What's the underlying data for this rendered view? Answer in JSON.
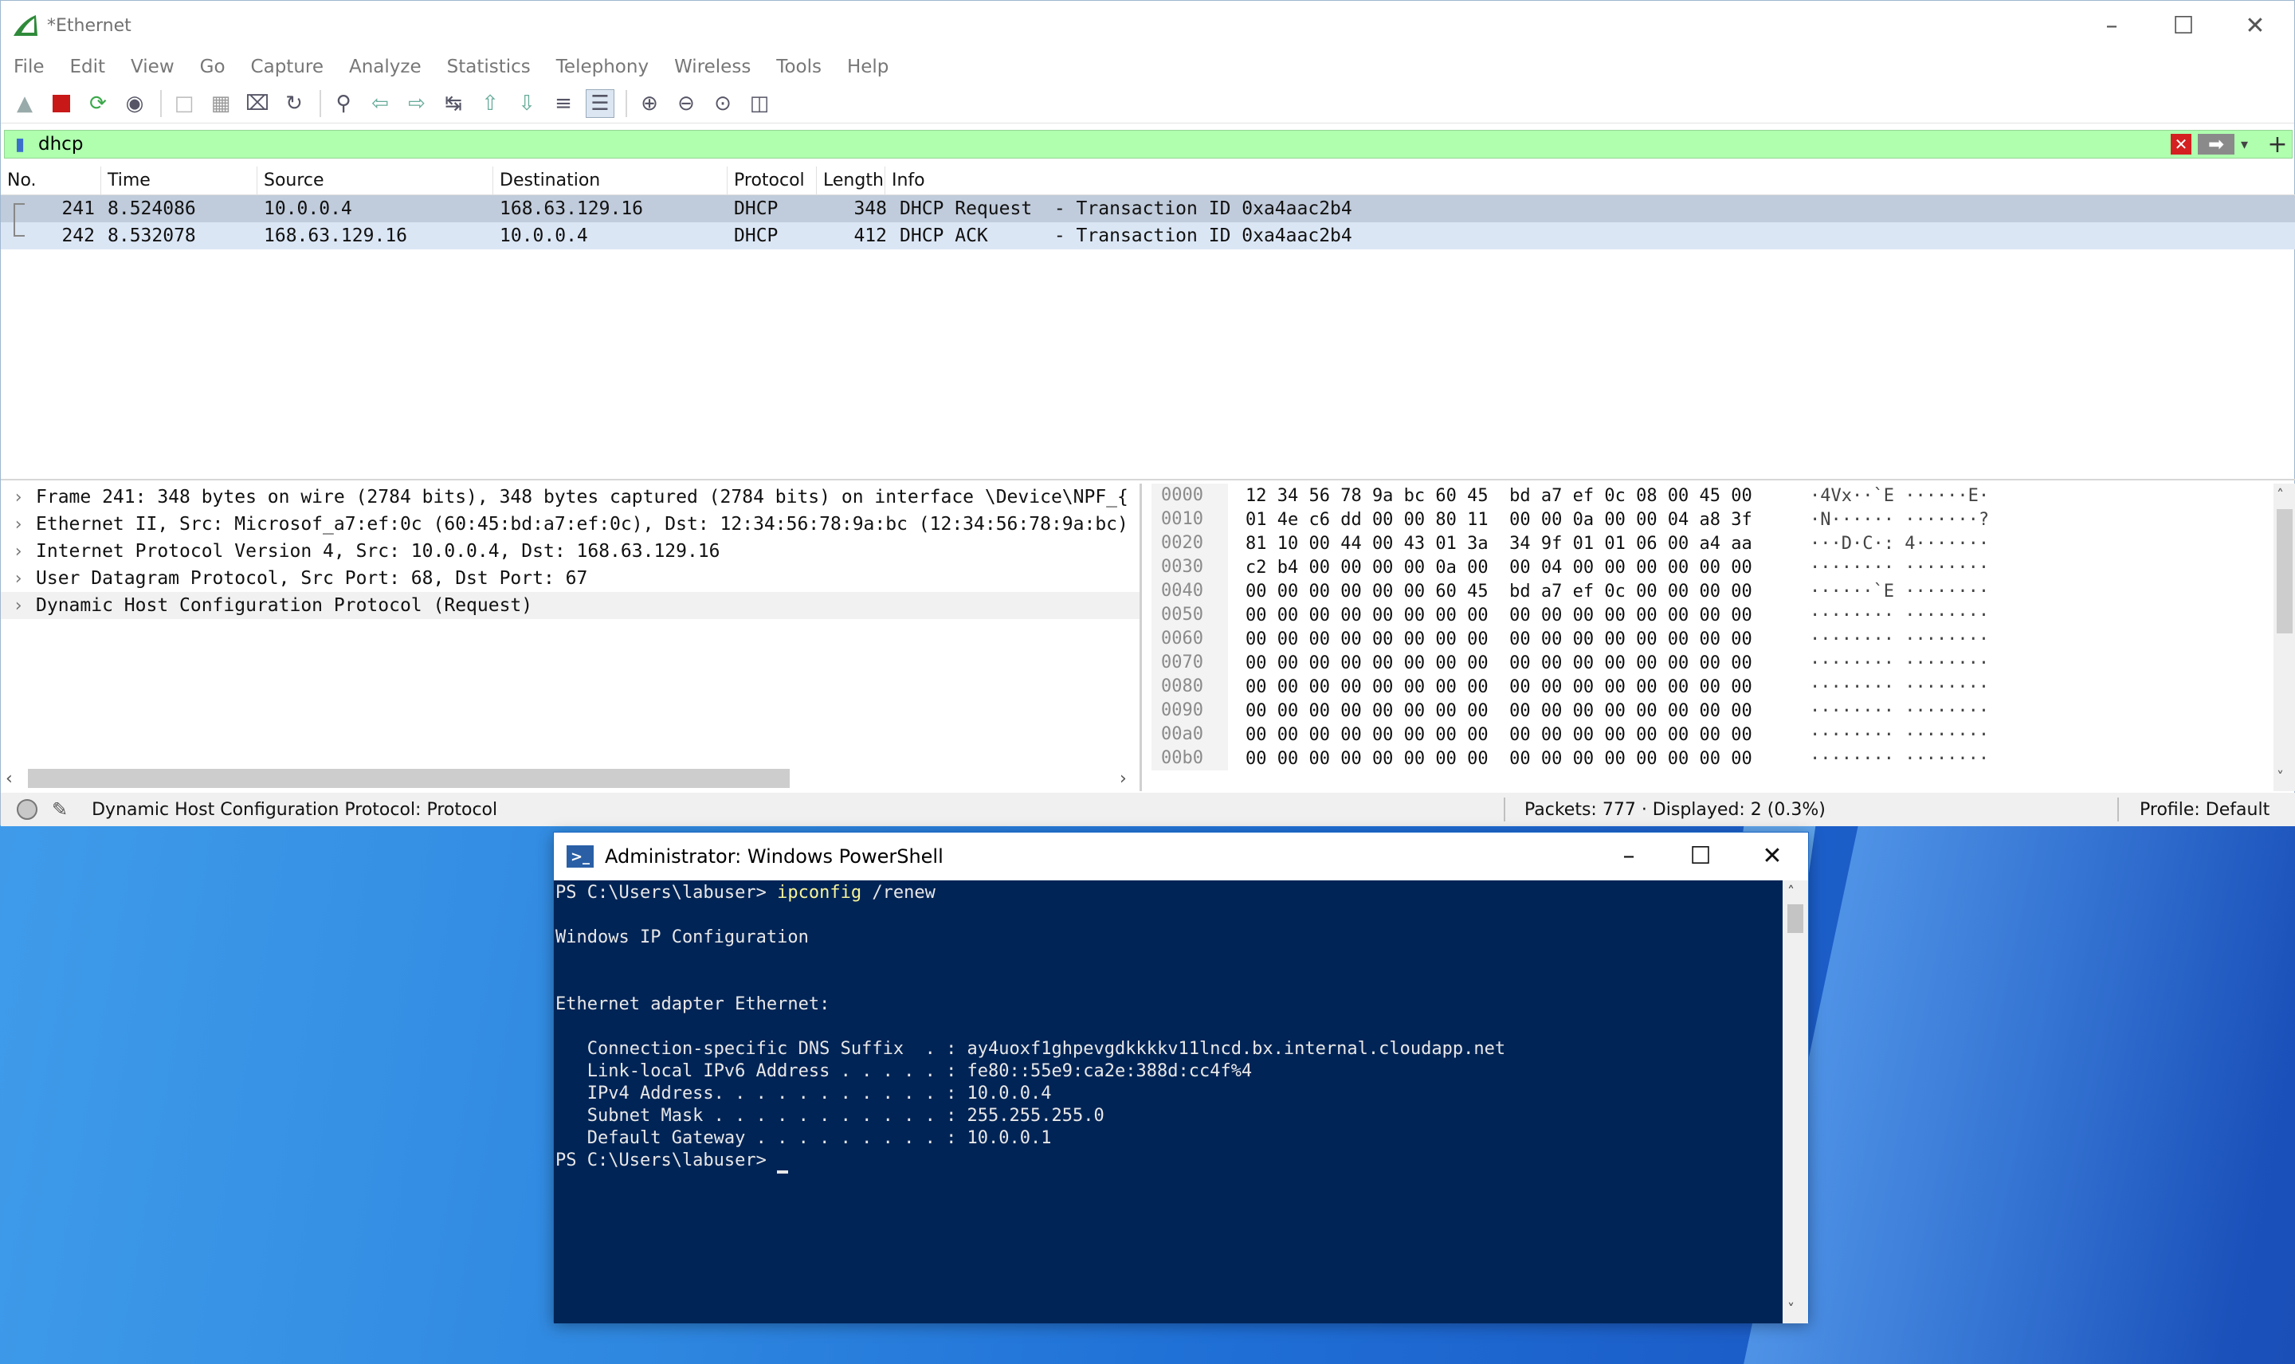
{
  "wireshark": {
    "title": "*Ethernet",
    "menu": [
      "File",
      "Edit",
      "View",
      "Go",
      "Capture",
      "Analyze",
      "Statistics",
      "Telephony",
      "Wireless",
      "Tools",
      "Help"
    ],
    "filter": {
      "value": "dhcp"
    },
    "columns": {
      "no": "No.",
      "time": "Time",
      "source": "Source",
      "destination": "Destination",
      "protocol": "Protocol",
      "length": "Length",
      "info": "Info"
    },
    "packets": [
      {
        "no": "241",
        "time": "8.524086",
        "source": "10.0.0.4",
        "destination": "168.63.129.16",
        "protocol": "DHCP",
        "length": "348",
        "info": "DHCP Request  - Transaction ID 0xa4aac2b4"
      },
      {
        "no": "242",
        "time": "8.532078",
        "source": "168.63.129.16",
        "destination": "10.0.0.4",
        "protocol": "DHCP",
        "length": "412",
        "info": "DHCP ACK      - Transaction ID 0xa4aac2b4"
      }
    ],
    "details": [
      "Frame 241: 348 bytes on wire (2784 bits), 348 bytes captured (2784 bits) on interface \\Device\\NPF_{",
      "Ethernet II, Src: Microsof_a7:ef:0c (60:45:bd:a7:ef:0c), Dst: 12:34:56:78:9a:bc (12:34:56:78:9a:bc)",
      "Internet Protocol Version 4, Src: 10.0.0.4, Dst: 168.63.129.16",
      "User Datagram Protocol, Src Port: 68, Dst Port: 67",
      "Dynamic Host Configuration Protocol (Request)"
    ],
    "bytes": [
      {
        "offset": "0000",
        "hex": "12 34 56 78 9a bc 60 45  bd a7 ef 0c 08 00 45 00",
        "ascii": "·4Vx··`E ······E·"
      },
      {
        "offset": "0010",
        "hex": "01 4e c6 dd 00 00 80 11  00 00 0a 00 00 04 a8 3f",
        "ascii": "·N······ ·······?"
      },
      {
        "offset": "0020",
        "hex": "81 10 00 44 00 43 01 3a  34 9f 01 01 06 00 a4 aa",
        "ascii": "···D·C·: 4·······"
      },
      {
        "offset": "0030",
        "hex": "c2 b4 00 00 00 00 0a 00  00 04 00 00 00 00 00 00",
        "ascii": "········ ········"
      },
      {
        "offset": "0040",
        "hex": "00 00 00 00 00 00 60 45  bd a7 ef 0c 00 00 00 00",
        "ascii": "······`E ········"
      },
      {
        "offset": "0050",
        "hex": "00 00 00 00 00 00 00 00  00 00 00 00 00 00 00 00",
        "ascii": "········ ········"
      },
      {
        "offset": "0060",
        "hex": "00 00 00 00 00 00 00 00  00 00 00 00 00 00 00 00",
        "ascii": "········ ········"
      },
      {
        "offset": "0070",
        "hex": "00 00 00 00 00 00 00 00  00 00 00 00 00 00 00 00",
        "ascii": "········ ········"
      },
      {
        "offset": "0080",
        "hex": "00 00 00 00 00 00 00 00  00 00 00 00 00 00 00 00",
        "ascii": "········ ········"
      },
      {
        "offset": "0090",
        "hex": "00 00 00 00 00 00 00 00  00 00 00 00 00 00 00 00",
        "ascii": "········ ········"
      },
      {
        "offset": "00a0",
        "hex": "00 00 00 00 00 00 00 00  00 00 00 00 00 00 00 00",
        "ascii": "········ ········"
      },
      {
        "offset": "00b0",
        "hex": "00 00 00 00 00 00 00 00  00 00 00 00 00 00 00 00",
        "ascii": "········ ········"
      }
    ],
    "status": {
      "field": "Dynamic Host Configuration Protocol: Protocol",
      "packets": "Packets: 777 · Displayed: 2 (0.3%)",
      "profile": "Profile: Default"
    }
  },
  "powershell": {
    "title": "Administrator: Windows PowerShell",
    "prompt": "PS C:\\Users\\labuser> ",
    "command": "ipconfig",
    "command_args": " /renew",
    "lines": [
      "",
      "Windows IP Configuration",
      "",
      "",
      "Ethernet adapter Ethernet:",
      "",
      "   Connection-specific DNS Suffix  . : ay4uoxf1ghpevgdkkkkv11lncd.bx.internal.cloudapp.net",
      "   Link-local IPv6 Address . . . . . : fe80::55e9:ca2e:388d:cc4f%4",
      "   IPv4 Address. . . . . . . . . . . : 10.0.0.4",
      "   Subnet Mask . . . . . . . . . . . : 255.255.255.0",
      "   Default Gateway . . . . . . . . . : 10.0.0.1"
    ],
    "final_prompt": "PS C:\\Users\\labuser> "
  }
}
